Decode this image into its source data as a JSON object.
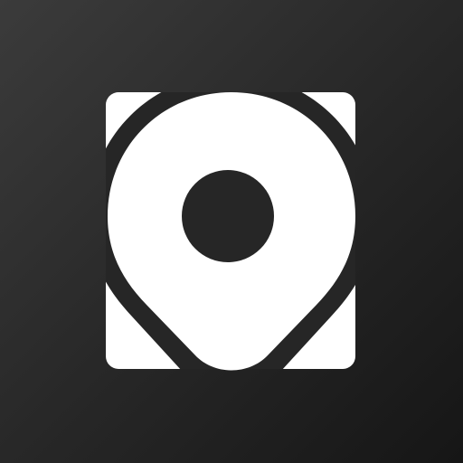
{
  "icon": {
    "name": "map-pin-logo-icon",
    "background_top_left": "#3b3b3b",
    "background_bottom_right": "#161616",
    "glyph_color": "#ffffff",
    "cutout_color": "#262626"
  }
}
